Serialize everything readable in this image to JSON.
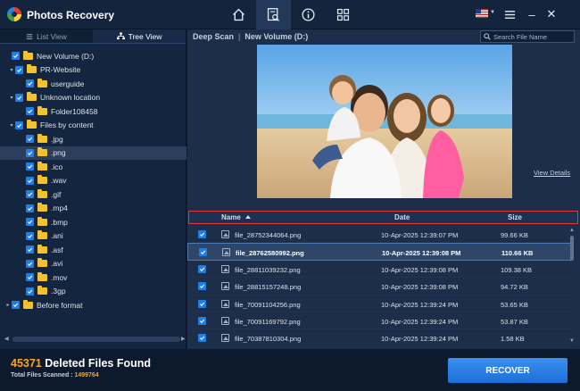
{
  "app": {
    "title": "Photos Recovery"
  },
  "nav": [
    "home-icon",
    "scan-document-icon",
    "info-icon",
    "grid-icon"
  ],
  "window": {
    "menu_icon": "hamburger-menu-icon",
    "minimize": "–",
    "close": "✕"
  },
  "tabs": [
    {
      "label": "List View",
      "active": false
    },
    {
      "label": "Tree View",
      "active": true
    }
  ],
  "tree": [
    {
      "label": "New Volume (D:)",
      "level": 0,
      "expander": ""
    },
    {
      "label": "PR-Website",
      "level": 1,
      "expander": "▾"
    },
    {
      "label": "userguide",
      "level": 2,
      "expander": ""
    },
    {
      "label": "Unknown location",
      "level": 1,
      "expander": "▾"
    },
    {
      "label": "Folder108458",
      "level": 2,
      "expander": ""
    },
    {
      "label": "Files by content",
      "level": 1,
      "expander": "▾"
    },
    {
      "label": ".jpg",
      "level": 2,
      "expander": ""
    },
    {
      "label": ".png",
      "level": 2,
      "expander": "",
      "selected": true
    },
    {
      "label": ".ico",
      "level": 2,
      "expander": ""
    },
    {
      "label": ".wav",
      "level": 2,
      "expander": ""
    },
    {
      "label": ".gif",
      "level": 2,
      "expander": ""
    },
    {
      "label": ".mp4",
      "level": 2,
      "expander": ""
    },
    {
      "label": ".bmp",
      "level": 2,
      "expander": ""
    },
    {
      "label": ".ani",
      "level": 2,
      "expander": ""
    },
    {
      "label": ".asf",
      "level": 2,
      "expander": ""
    },
    {
      "label": ".avi",
      "level": 2,
      "expander": ""
    },
    {
      "label": ".mov",
      "level": 2,
      "expander": ""
    },
    {
      "label": ".3gp",
      "level": 2,
      "expander": ""
    },
    {
      "label": "Before format",
      "level": 0,
      "expander": "▸"
    }
  ],
  "breadcrumb": {
    "scan": "Deep Scan",
    "separator": "|",
    "volume": "New Volume (D:)"
  },
  "search": {
    "placeholder": "Search File Name",
    "value": ""
  },
  "preview": {
    "view_details": "View Details"
  },
  "table": {
    "headers": {
      "name": "Name",
      "date": "Date",
      "size": "Size"
    },
    "rows": [
      {
        "name": "file_28752344064.png",
        "date": "10-Apr-2025 12:39:07 PM",
        "size": "99.66 KB",
        "selected": false
      },
      {
        "name": "file_28762580992.png",
        "date": "10-Apr-2025 12:39:08 PM",
        "size": "110.66 KB",
        "selected": true
      },
      {
        "name": "file_28811039232.png",
        "date": "10-Apr-2025 12:39:08 PM",
        "size": "109.38 KB",
        "selected": false
      },
      {
        "name": "file_28815157248.png",
        "date": "10-Apr-2025 12:39:08 PM",
        "size": "94.72 KB",
        "selected": false
      },
      {
        "name": "file_70091104256.png",
        "date": "10-Apr-2025 12:39:24 PM",
        "size": "53.65 KB",
        "selected": false
      },
      {
        "name": "file_70091169792.png",
        "date": "10-Apr-2025 12:39:24 PM",
        "size": "53.87 KB",
        "selected": false
      },
      {
        "name": "file_70387810304.png",
        "date": "10-Apr-2025 12:39:24 PM",
        "size": "1.58 KB",
        "selected": false
      }
    ]
  },
  "footer": {
    "found_count": "45371",
    "found_label": " Deleted Files Found",
    "scanned_label": "Total Files Scanned : ",
    "scanned_count": "1499764",
    "recover_label": "RECOVER"
  },
  "colors": {
    "accent": "#1f7ee6",
    "highlight": "#e53935",
    "count": "#f5a623"
  }
}
